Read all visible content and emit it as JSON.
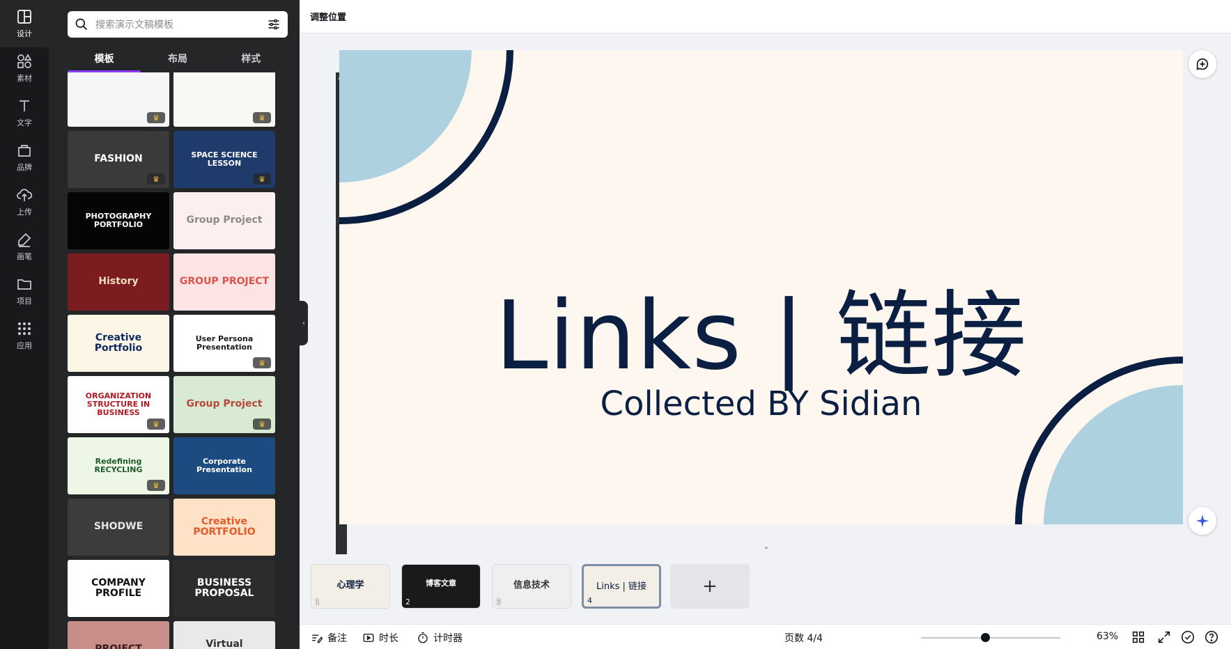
{
  "rail": [
    {
      "label": "设计",
      "icon": "design-icon",
      "active": true
    },
    {
      "label": "素材",
      "icon": "elements-icon"
    },
    {
      "label": "文字",
      "icon": "text-icon"
    },
    {
      "label": "品牌",
      "icon": "brand-icon"
    },
    {
      "label": "上传",
      "icon": "upload-icon"
    },
    {
      "label": "画笔",
      "icon": "draw-icon"
    },
    {
      "label": "项目",
      "icon": "folder-icon"
    },
    {
      "label": "应用",
      "icon": "apps-icon"
    }
  ],
  "search": {
    "placeholder": "搜索演示文稿模板"
  },
  "tabs": [
    "模板",
    "布局",
    "样式"
  ],
  "templates": [
    {
      "text": "",
      "bg": "#f4f6f8",
      "fg": "#1c9bd8",
      "crown": true
    },
    {
      "text": "",
      "bg": "#f7f7f3",
      "fg": "#2b8a6d",
      "crown": true
    },
    {
      "text": "FASHION",
      "bg": "#3a3a3a",
      "fg": "#ffffff",
      "crown": true
    },
    {
      "text": "SPACE SCIENCE LESSON",
      "bg": "#1f3b6b",
      "fg": "#ffffff",
      "crown": true
    },
    {
      "text": "PHOTOGRAPHY PORTFOLIO",
      "bg": "#050505",
      "fg": "#ffffff",
      "crown": false
    },
    {
      "text": "Group Project",
      "bg": "#fbefef",
      "fg": "#8a8a8a",
      "crown": false
    },
    {
      "text": "History",
      "bg": "#7b1c21",
      "fg": "#f1dfbf",
      "crown": false
    },
    {
      "text": "GROUP PROJECT",
      "bg": "#fde4e4",
      "fg": "#d9544c",
      "crown": false
    },
    {
      "text": "Creative Portfolio",
      "bg": "#fbf6e6",
      "fg": "#0e2a63",
      "crown": false
    },
    {
      "text": "User Persona Presentation",
      "bg": "#ffffff",
      "fg": "#1a1a1a",
      "crown": true
    },
    {
      "text": "ORGANIZATION STRUCTURE IN BUSINESS",
      "bg": "#ffffff",
      "fg": "#b01823",
      "crown": true
    },
    {
      "text": "Group Project",
      "bg": "#d9ead3",
      "fg": "#b6463a",
      "crown": true
    },
    {
      "text": "Redefining RECYCLING",
      "bg": "#eef6e5",
      "fg": "#1d5a2a",
      "crown": true
    },
    {
      "text": "Corporate Presentation",
      "bg": "#1c4b82",
      "fg": "#ffffff",
      "crown": false
    },
    {
      "text": "SHODWE",
      "bg": "#3c3c3c",
      "fg": "#e6e6e6",
      "crown": false
    },
    {
      "text": "Creative PORTFOLIO",
      "bg": "#fde2c8",
      "fg": "#e25b2b",
      "crown": false
    },
    {
      "text": "COMPANY PROFILE",
      "bg": "#ffffff",
      "fg": "#111111",
      "crown": false
    },
    {
      "text": "BUSINESS PROPOSAL",
      "bg": "#2c2c2c",
      "fg": "#ffffff",
      "crown": false
    },
    {
      "text": "PROJECT",
      "bg": "#c98e8a",
      "fg": "#3a1a1a",
      "crown": false
    },
    {
      "text": "Virtual Technology",
      "bg": "#e9e9e9",
      "fg": "#333333",
      "crown": false
    }
  ],
  "topbar": {
    "title": "调整位置"
  },
  "slide": {
    "title": "Links | 链接",
    "subtitle": "Collected BY Sidian",
    "colors": {
      "background": "#fdf7f0",
      "navy": "#0b1f42",
      "lightblue": "#aed1df"
    }
  },
  "pages": [
    {
      "number": "1",
      "label": "心理学",
      "bg": "#f3efe6",
      "fg": "#1d2b3a"
    },
    {
      "number": "2",
      "label": "博客文章",
      "bg": "#1a1a1a",
      "fg": "#ffffff"
    },
    {
      "number": "3",
      "label": "信息技术",
      "bg": "#efefef",
      "fg": "#333333"
    },
    {
      "number": "4",
      "label": "Links | 链接",
      "bg": "#fdf7f0",
      "fg": "#0b1f42",
      "active": true
    }
  ],
  "add_page": "+",
  "bottom": {
    "notes": "备注",
    "duration": "时长",
    "timer": "计时器",
    "page_indicator": "页数 4/4",
    "zoom": "63%"
  }
}
